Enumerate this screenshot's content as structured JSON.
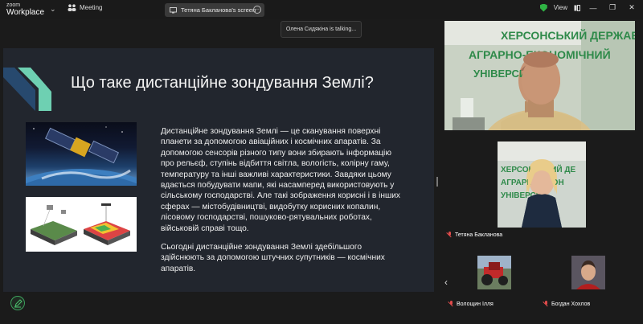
{
  "app": {
    "logo_top": "zoom",
    "logo_bottom": "Workplace"
  },
  "meeting": {
    "label": "Meeting"
  },
  "share_pill": {
    "label": "Тетяна Бакланова's screen",
    "more": "…"
  },
  "talking": {
    "text": "Олена Сидякіна is talking..."
  },
  "view": {
    "label": "View"
  },
  "colors": {
    "accent_green": "#2fb344",
    "slide_bg": "#22262e",
    "accent_teal": "#6ed0b2",
    "accent_navy": "#27496e"
  },
  "slide": {
    "title": "Що таке дистанційне зондування Землі?",
    "paragraph1": "Дистанційне зондування Землі — це сканування поверхні планети за допомогою авіаційних і космічних апаратів. За допомогою сенсорів різного типу вони збирають інформацію про рельєф, ступінь відбиття світла, вологість, колірну гаму, температуру та інші важливі характеристики. Завдяки цьому вдається побудувати мапи, які насамперед використовують у сільському господарстві. Але такі зображення корисні і в інших сферах — містобудівництві, видобутку корисних копалин, лісовому господарстві, пошуково-рятувальних роботах, військовій справі тощо.",
    "paragraph2": "Сьогодні дистанційне зондування Землі здебільшого здійснюють за допомогою штучних супутників — космічних апаратів."
  },
  "video": {
    "main": {
      "wall_line1": "ХЕРСОНСЬКИЙ ДЕРЖАВНИЙ",
      "wall_line2": "АГРАРНО-ЕКОНОМІЧНИЙ",
      "wall_line3": "УНІВЕРСИТЕТ"
    },
    "second": {
      "name": "Тетяна Бакланова",
      "wall_line1": "ХЕРСОНСЬКИЙ ДЕ",
      "wall_line2": "АГРАРНО-ЕКОН",
      "wall_line3": "УНІВЕРСИ"
    }
  },
  "participants": [
    {
      "name": "Волощин Ілля"
    },
    {
      "name": "Богдан Хохлов"
    }
  ]
}
